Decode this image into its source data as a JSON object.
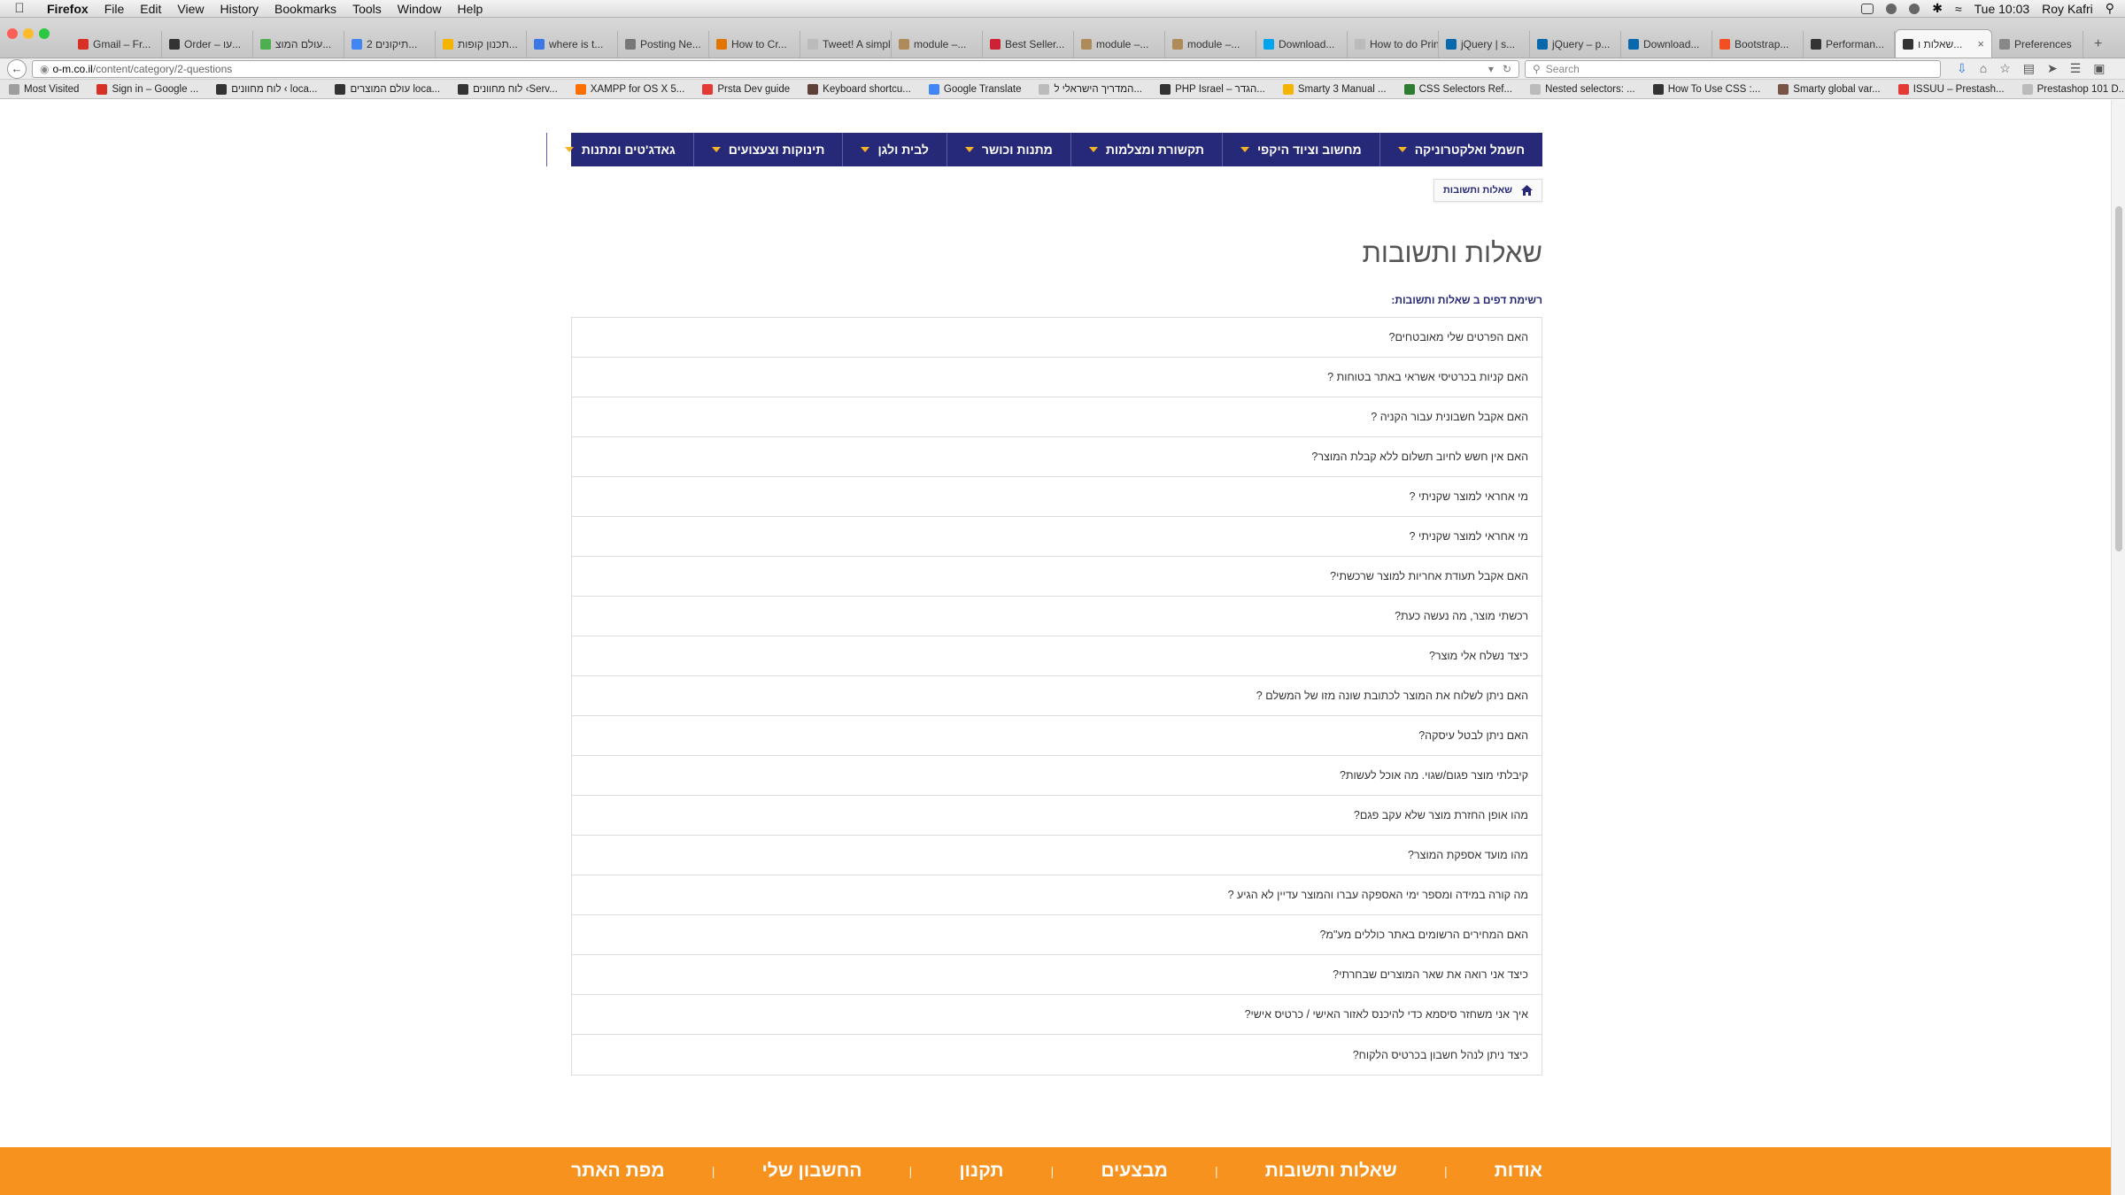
{
  "menubar": {
    "items": [
      "Firefox",
      "File",
      "Edit",
      "View",
      "History",
      "Bookmarks",
      "Tools",
      "Window",
      "Help"
    ],
    "clock": "Tue 10:03",
    "user": "Roy Kafri"
  },
  "tabs": [
    {
      "label": "Gmail – Fr...",
      "color": "#d93025"
    },
    {
      "label": "Order – עו...",
      "color": "#333333"
    },
    {
      "label": "עולם המוצ...",
      "color": "#4caf50"
    },
    {
      "label": "2 תיקונים...",
      "color": "#4285f4"
    },
    {
      "label": "תכנון קופות...",
      "color": "#f4b400"
    },
    {
      "label": "where is t...",
      "color": "#3b78e7"
    },
    {
      "label": "Posting Ne...",
      "color": "#777777"
    },
    {
      "label": "How to Cr...",
      "color": "#e37400"
    },
    {
      "label": "Tweet! A simpl...",
      "color": "#bbbbbb"
    },
    {
      "label": "module –...",
      "color": "#b08b5a"
    },
    {
      "label": "Best Seller...",
      "color": "#cc2233"
    },
    {
      "label": "module –...",
      "color": "#b08b5a"
    },
    {
      "label": "module –...",
      "color": "#b08b5a"
    },
    {
      "label": "Download...",
      "color": "#00a4ef"
    },
    {
      "label": "How to do Prin...",
      "color": "#bbbbbb"
    },
    {
      "label": "jQuery | s...",
      "color": "#0769ad"
    },
    {
      "label": "jQuery – p...",
      "color": "#0769ad"
    },
    {
      "label": "Download...",
      "color": "#0769ad"
    },
    {
      "label": "Bootstrap...",
      "color": "#f25022"
    },
    {
      "label": "Performan...",
      "color": "#333333"
    },
    {
      "label": "שאלות ו...",
      "color": "#333333",
      "active": true
    },
    {
      "label": "Preferences",
      "color": "#888888"
    }
  ],
  "navbar": {
    "url_host": "o-m.co.il",
    "url_path": "/content/category/2-questions",
    "search_placeholder": "Search"
  },
  "bookmarks": [
    "Most Visited",
    "Sign in – Google ...",
    "לוח מחוונים ‹ loca...",
    "עולם המוצרים loca...",
    "לוח מחוונים ‹Serv...",
    "XAMPP for OS X 5...",
    "Prsta Dev guide",
    "Keyboard shortcu...",
    "Google Translate",
    "המדריך הישראלי ל...",
    "PHP Israel – הגדר...",
    "Smarty 3 Manual ...",
    "CSS Selectors Ref...",
    "Nested selectors: ...",
    "How To Use CSS :...",
    "Smarty global var...",
    "ISSUU – Prestash...",
    "Prestashop 101 D..."
  ],
  "site": {
    "nav": [
      "חשמל ואלקטרוניקה",
      "מחשוב וציוד היקפי",
      "תקשורת ומצלמות",
      "מתנות וכושר",
      "לבית ולגן",
      "תינוקות וצעצועים",
      "גאדג'טים ומתנות"
    ],
    "breadcrumb": "שאלות ותשובות",
    "title": "שאלות ותשובות",
    "list_caption": "רשימת דפים ב שאלות ותשובות:",
    "questions": [
      "האם הפרטים שלי מאובטחים?",
      "האם קניות בכרטיסי אשראי באתר בטוחות ?",
      "האם אקבל חשבונית עבור הקניה ?",
      "האם אין חשש לחיוב תשלום ללא קבלת המוצר?",
      "מי אחראי למוצר שקניתי ?",
      "מי אחראי למוצר שקניתי ?",
      "האם אקבל תעודת אחריות למוצר שרכשתי?",
      "רכשתי מוצר, מה נעשה כעת?",
      "כיצד נשלח אלי מוצר?",
      "האם ניתן לשלוח את המוצר לכתובת שונה מזו של המשלם ?",
      "האם ניתן לבטל עיסקה?",
      "קיבלתי מוצר פגום/שגוי. מה אוכל לעשות?",
      "מהו אופן החזרת מוצר שלא עקב פגם?",
      "מהו מועד אספקת המוצר?",
      "מה קורה במידה ומספר ימי האספקה עברו והמוצר עדיין לא הגיע ?",
      "האם המחירים הרשומים באתר כוללים מע\"מ?",
      "כיצד אני רואה את שאר המוצרים שבחרתי?",
      "איך אני משחזר סיסמא כדי להיכנס לאזור האישי / כרטיס אישי?",
      "כיצד ניתן לנהל חשבון בכרטיס הלקוח?"
    ],
    "footer": [
      "אודות",
      "שאלות ותשובות",
      "מבצעים",
      "תקנון",
      "החשבון שלי",
      "מפת האתר"
    ]
  },
  "colors": {
    "nav_bg": "#262978",
    "nav_caret": "#f5b325",
    "footer_bg": "#f7921e"
  }
}
